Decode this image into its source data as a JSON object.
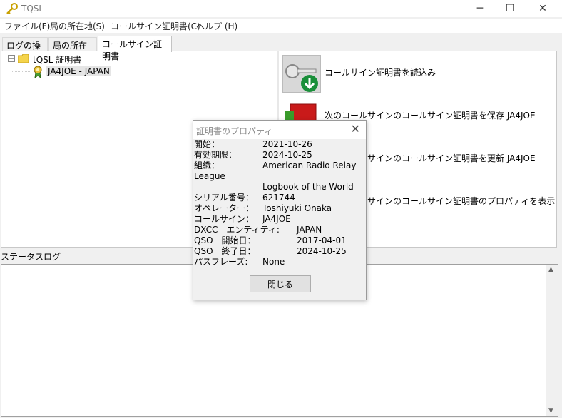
{
  "window": {
    "title": "TQSL"
  },
  "menu": [
    "ファイル(F)",
    "局の所在地(S)",
    "コールサイン証明書(C)",
    "ヘルプ (H)"
  ],
  "tabs": [
    "ログの操作",
    "局の所在地",
    "コールサイン証明書"
  ],
  "tree": {
    "root": "tQSL 証明書",
    "child": "JA4JOE - JAPAN"
  },
  "actions": [
    "コールサイン証明書を読込み",
    "次のコールサインのコールサイン証明書を保存 JA4JOE",
    "次のコールサインのコールサイン証明書を更新 JA4JOE",
    "次のコールサインのコールサイン証明書のプロパティを表示"
  ],
  "status_log_label": "ステータスログ",
  "dialog": {
    "title": "証明書のプロパティ",
    "close_button": "閉じる",
    "props": {
      "start_label": "開始：",
      "start_value": "2021-10-26",
      "expiry_label": "有効期限：",
      "expiry_value": "2024-10-25",
      "org_label": "組織：",
      "org_value": "American Radio Relay",
      "org_cont": "League",
      "org_value2": "Logbook of the World",
      "serial_label": "シリアル番号：",
      "serial_value": "621744",
      "operator_label": "オペレーター：",
      "operator_value": "Toshiyuki Onaka",
      "callsign_label": "コールサイン：",
      "callsign_value": "JA4JOE",
      "dxcc_label": "DXCC　エンティティ:",
      "dxcc_value": "JAPAN",
      "qso_start_label": "QSO　開始日：",
      "qso_start_value": "2017-04-01",
      "qso_end_label": "QSO　終了日：",
      "qso_end_value": "2024-10-25",
      "pass_label": "パスフレーズ:",
      "pass_value": "None"
    }
  }
}
